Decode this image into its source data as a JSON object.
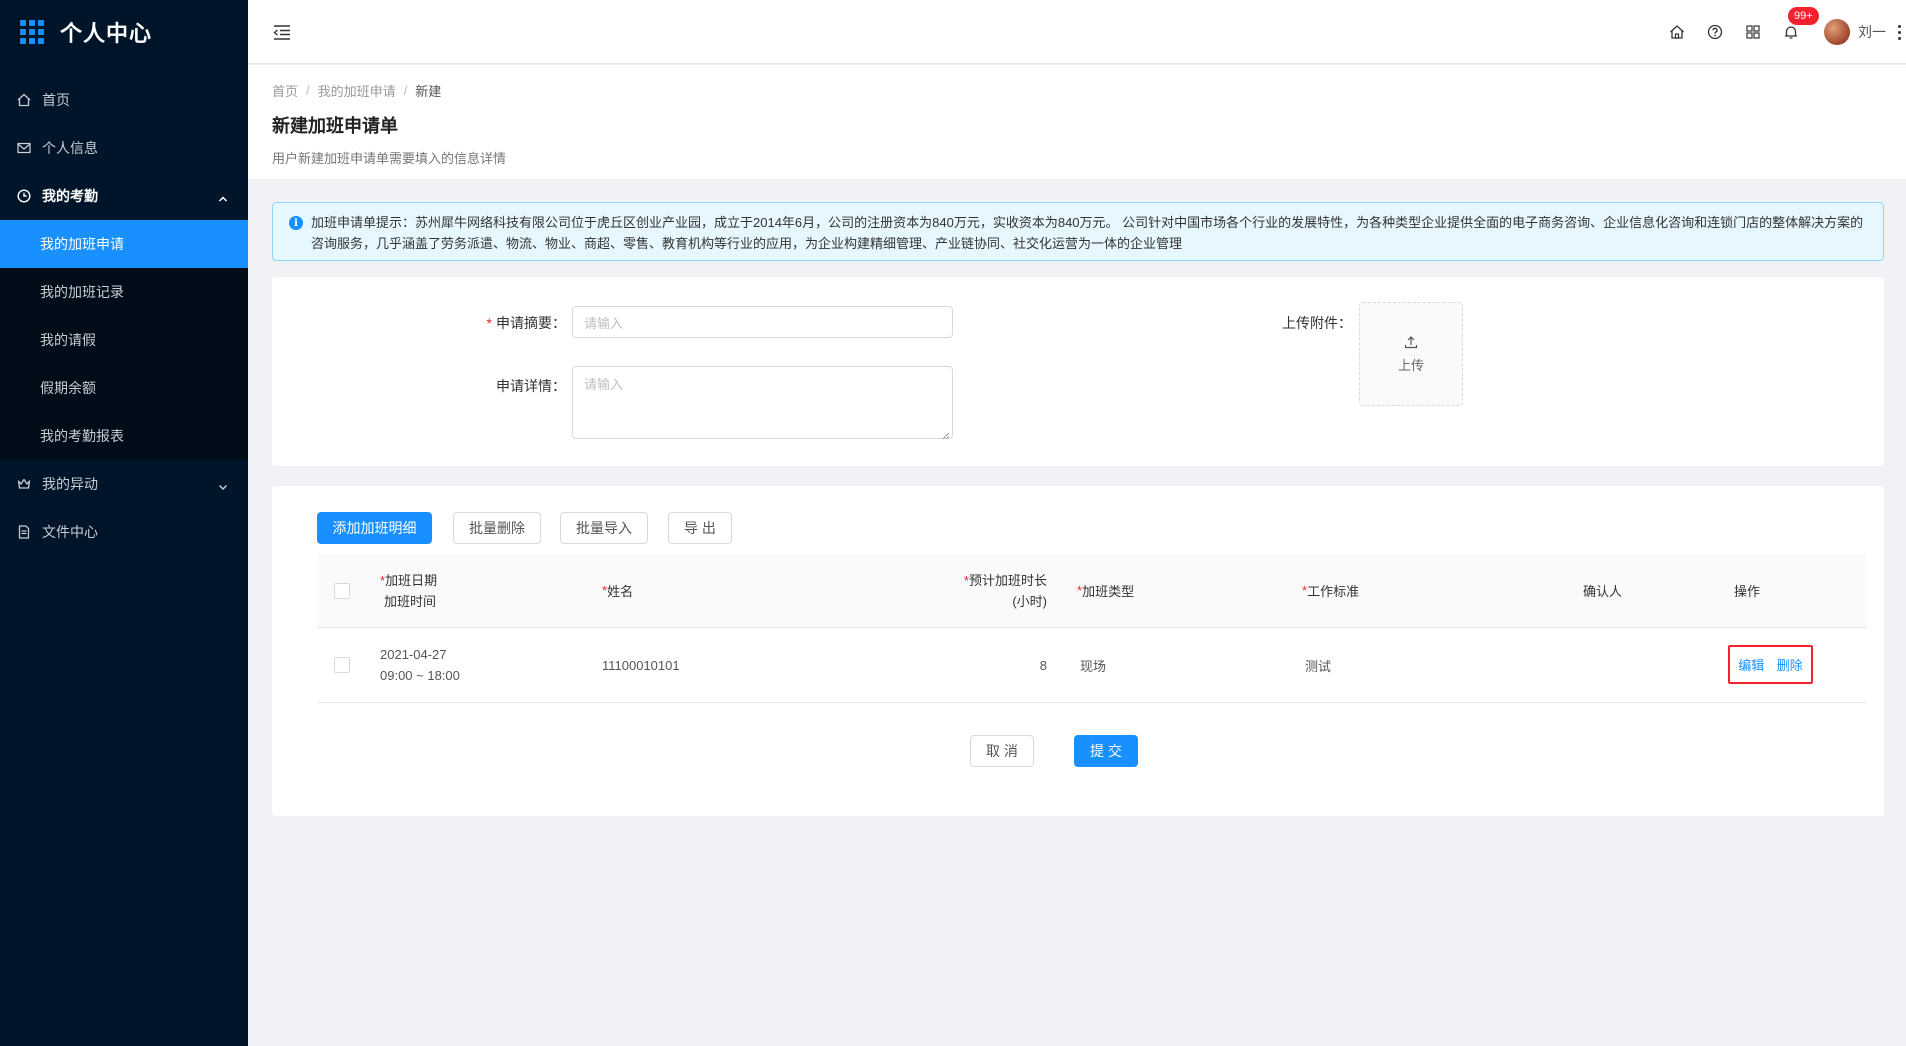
{
  "app": {
    "title": "个人中心"
  },
  "sidebar": {
    "items": [
      {
        "label": "首页",
        "icon": "home-icon"
      },
      {
        "label": "个人信息",
        "icon": "mail-icon"
      },
      {
        "label": "我的考勤",
        "icon": "clock-icon",
        "expanded": true,
        "children": [
          {
            "label": "我的加班申请",
            "active": true
          },
          {
            "label": "我的加班记录"
          },
          {
            "label": "我的请假"
          },
          {
            "label": "假期余额"
          },
          {
            "label": "我的考勤报表"
          }
        ]
      },
      {
        "label": "我的异动",
        "icon": "crown-icon",
        "expanded": false
      },
      {
        "label": "文件中心",
        "icon": "file-icon"
      }
    ]
  },
  "header": {
    "notification_badge": "99+",
    "user_name": "刘一"
  },
  "breadcrumb": {
    "home": "首页",
    "parent": "我的加班申请",
    "current": "新建"
  },
  "page": {
    "title": "新建加班申请单",
    "description": "用户新建加班申请单需要填入的信息详情"
  },
  "alert": {
    "text": "加班申请单提示：苏州犀牛网络科技有限公司位于虎丘区创业产业园，成立于2014年6月，公司的注册资本为840万元，实收资本为840万元。 公司针对中国市场各个行业的发展特性，为各种类型企业提供全面的电子商务咨询、企业信息化咨询和连锁门店的整体解决方案的咨询服务，几乎涵盖了劳务派遣、物流、物业、商超、零售、教育机构等行业的应用，为企业构建精细管理、产业链协同、社交化运营为一体的企业管理"
  },
  "form": {
    "summary_label": "申请摘要：",
    "summary_placeholder": "请输入",
    "detail_label": "申请详情：",
    "detail_placeholder": "请输入",
    "upload_label": "上传附件：",
    "upload_text": "上传"
  },
  "toolbar": {
    "add": "添加加班明细",
    "batch_delete": "批量删除",
    "batch_import": "批量导入",
    "export": "导 出"
  },
  "table": {
    "headers": {
      "date": "加班日期",
      "time": "加班时间",
      "name": "姓名",
      "hours": "预计加班时长",
      "hours_unit": "(小时)",
      "type": "加班类型",
      "standard": "工作标准",
      "confirmer": "确认人",
      "actions": "操作"
    },
    "rows": [
      {
        "date": "2021-04-27",
        "time": "09:00 ~ 18:00",
        "name": "11100010101",
        "hours": "8",
        "type": "现场",
        "standard": "测试",
        "confirmer": ""
      }
    ],
    "edit": "编辑",
    "delete": "删除"
  },
  "footer": {
    "cancel": "取 消",
    "submit": "提 交"
  },
  "colors": {
    "primary": "#1890ff",
    "sidebar_bg": "#001529",
    "danger": "#f5222d"
  }
}
